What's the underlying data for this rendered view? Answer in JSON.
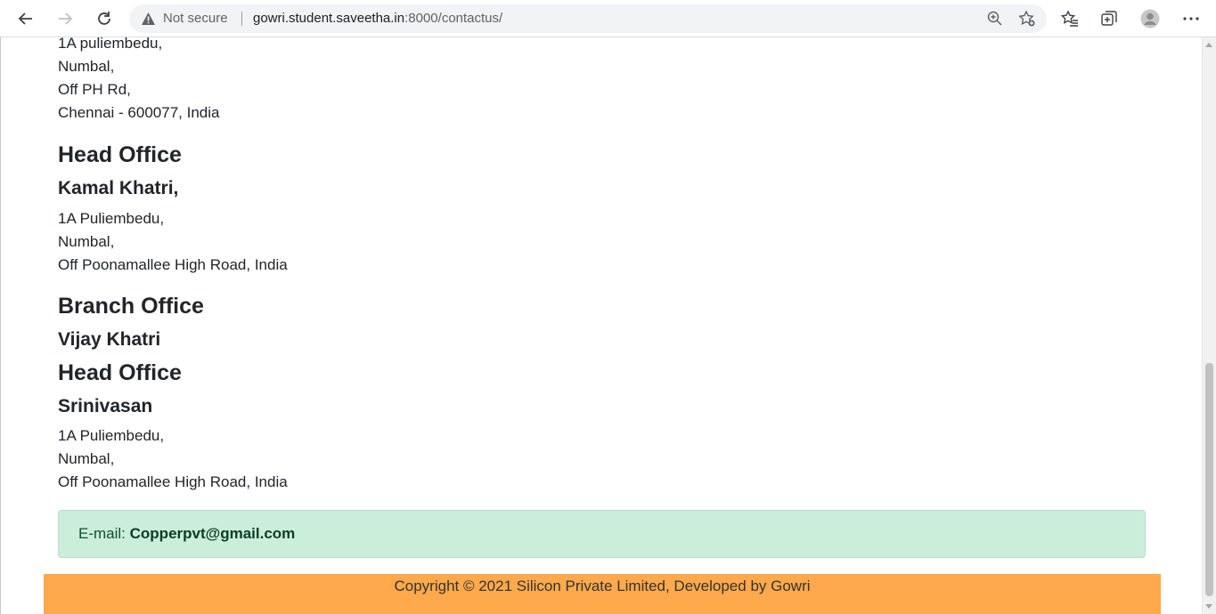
{
  "browser": {
    "not_secure": "Not secure",
    "url_host": "gowri.student.saveetha.in",
    "url_path": ":8000/contactus/"
  },
  "address_top": [
    "1A puliembedu,",
    "Numbal,",
    "Off PH Rd,",
    "Chennai - 600077, India"
  ],
  "head_office_1": {
    "heading": "Head Office",
    "name": "Kamal Khatri,",
    "lines": [
      "1A Puliembedu,",
      "Numbal,",
      "Off Poonamallee High Road, India"
    ]
  },
  "branch_office": {
    "heading": "Branch Office",
    "name": "Vijay Khatri"
  },
  "head_office_2": {
    "heading": "Head Office",
    "name": "Srinivasan",
    "lines": [
      "1A Puliembedu,",
      "Numbal,",
      "Off Poonamallee High Road, India"
    ]
  },
  "email": {
    "label": "E-mail:",
    "value": "Copperpvt@gmail.com"
  },
  "footer": {
    "text": "Copyright © 2021 Silicon Private Limited, Developed by Gowri"
  },
  "colors": {
    "alert_bg": "#cbeedb",
    "footer_bg": "#fea94c"
  }
}
